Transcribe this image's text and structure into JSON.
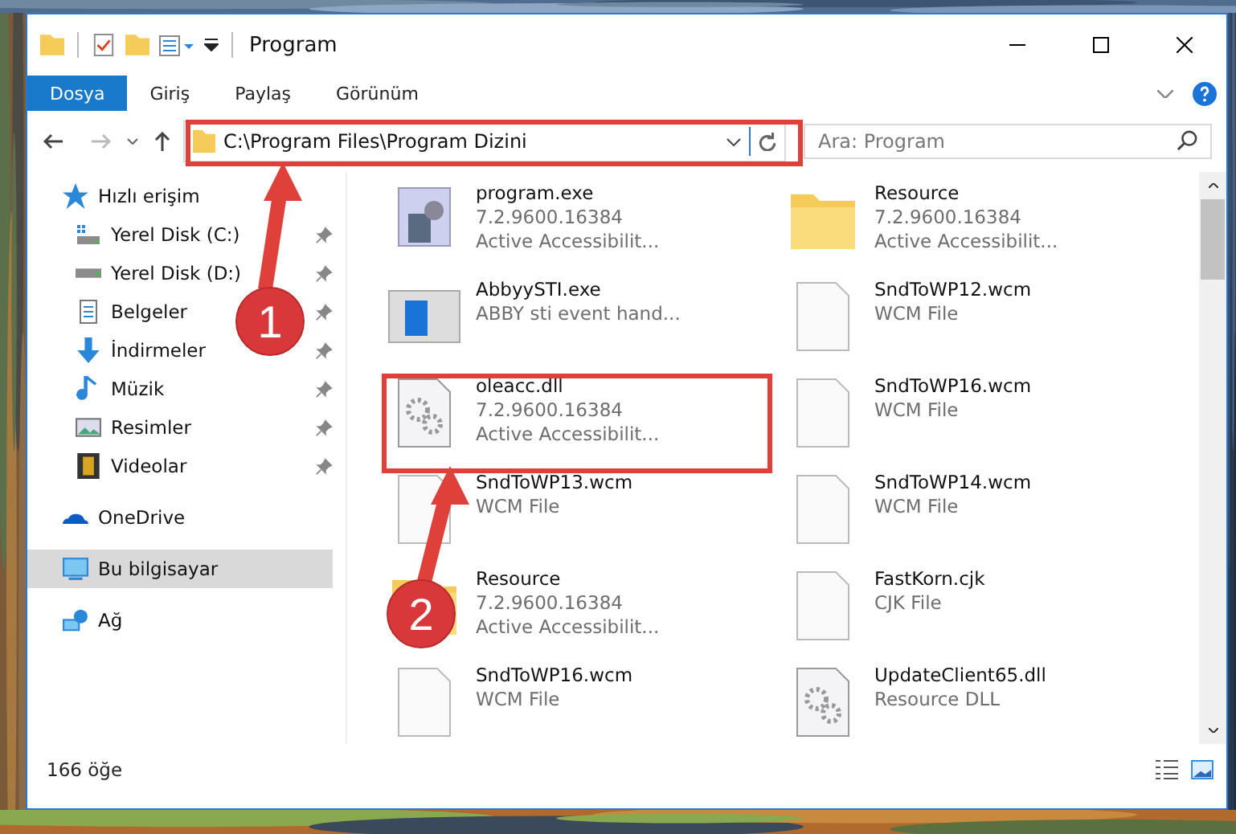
{
  "window": {
    "title": "Program"
  },
  "ribbon_tabs": [
    {
      "label": "Dosya",
      "selected": true
    },
    {
      "label": "Giriş",
      "selected": false
    },
    {
      "label": "Paylaş",
      "selected": false
    },
    {
      "label": "Görünüm",
      "selected": false
    }
  ],
  "address_bar": {
    "path": "C:\\Program Files\\Program Dizini"
  },
  "search": {
    "placeholder": "Ara: Program"
  },
  "sidebar": {
    "items": [
      {
        "label": "Hızlı erişim",
        "selected": false,
        "children": [
          {
            "label": "Yerel Disk (C:)",
            "pinned": true,
            "selected": false
          },
          {
            "label": "Yerel Disk (D:)",
            "pinned": true,
            "selected": false
          },
          {
            "label": "Belgeler",
            "pinned": true,
            "selected": false
          },
          {
            "label": "İndirmeler",
            "pinned": true,
            "selected": false
          },
          {
            "label": "Müzik",
            "pinned": true,
            "selected": false
          },
          {
            "label": "Resimler",
            "pinned": true,
            "selected": false
          },
          {
            "label": "Videolar",
            "pinned": true,
            "selected": false
          }
        ]
      },
      {
        "label": "OneDrive",
        "selected": false
      },
      {
        "label": "Bu bilgisayar",
        "selected": true
      },
      {
        "label": "Ağ",
        "selected": false
      }
    ]
  },
  "files": [
    {
      "name": "program.exe",
      "details": [
        "7.2.9600.16384",
        "Active Accessibilit..."
      ]
    },
    {
      "name": "Resource",
      "details": [
        "7.2.9600.16384",
        "Active Accessibilit..."
      ]
    },
    {
      "name": "AbbyySTI.exe",
      "details": [
        "ABBY sti event hand..."
      ]
    },
    {
      "name": "SndToWP12.wcm",
      "details": [
        "WCM File"
      ]
    },
    {
      "name": "oleacc.dll",
      "details": [
        "7.2.9600.16384",
        "Active Accessibilit..."
      ]
    },
    {
      "name": "SndToWP16.wcm",
      "details": [
        "WCM File"
      ]
    },
    {
      "name": "SndToWP13.wcm",
      "details": [
        "WCM File"
      ]
    },
    {
      "name": "SndToWP14.wcm",
      "details": [
        "WCM File"
      ]
    },
    {
      "name": "Resource",
      "details": [
        "7.2.9600.16384",
        "Active Accessibilit..."
      ]
    },
    {
      "name": "FastKorn.cjk",
      "details": [
        "CJK File"
      ]
    },
    {
      "name": "SndToWP16.wcm",
      "details": [
        "WCM File"
      ]
    },
    {
      "name": "UpdateClient65.dll",
      "details": [
        "Resource DLL"
      ]
    }
  ],
  "status_bar": {
    "item_count": "166 öğe"
  },
  "annotations": [
    {
      "kind": "box"
    },
    {
      "kind": "box"
    },
    {
      "kind": "arrow",
      "number": "1"
    },
    {
      "kind": "arrow",
      "number": "2"
    }
  ]
}
